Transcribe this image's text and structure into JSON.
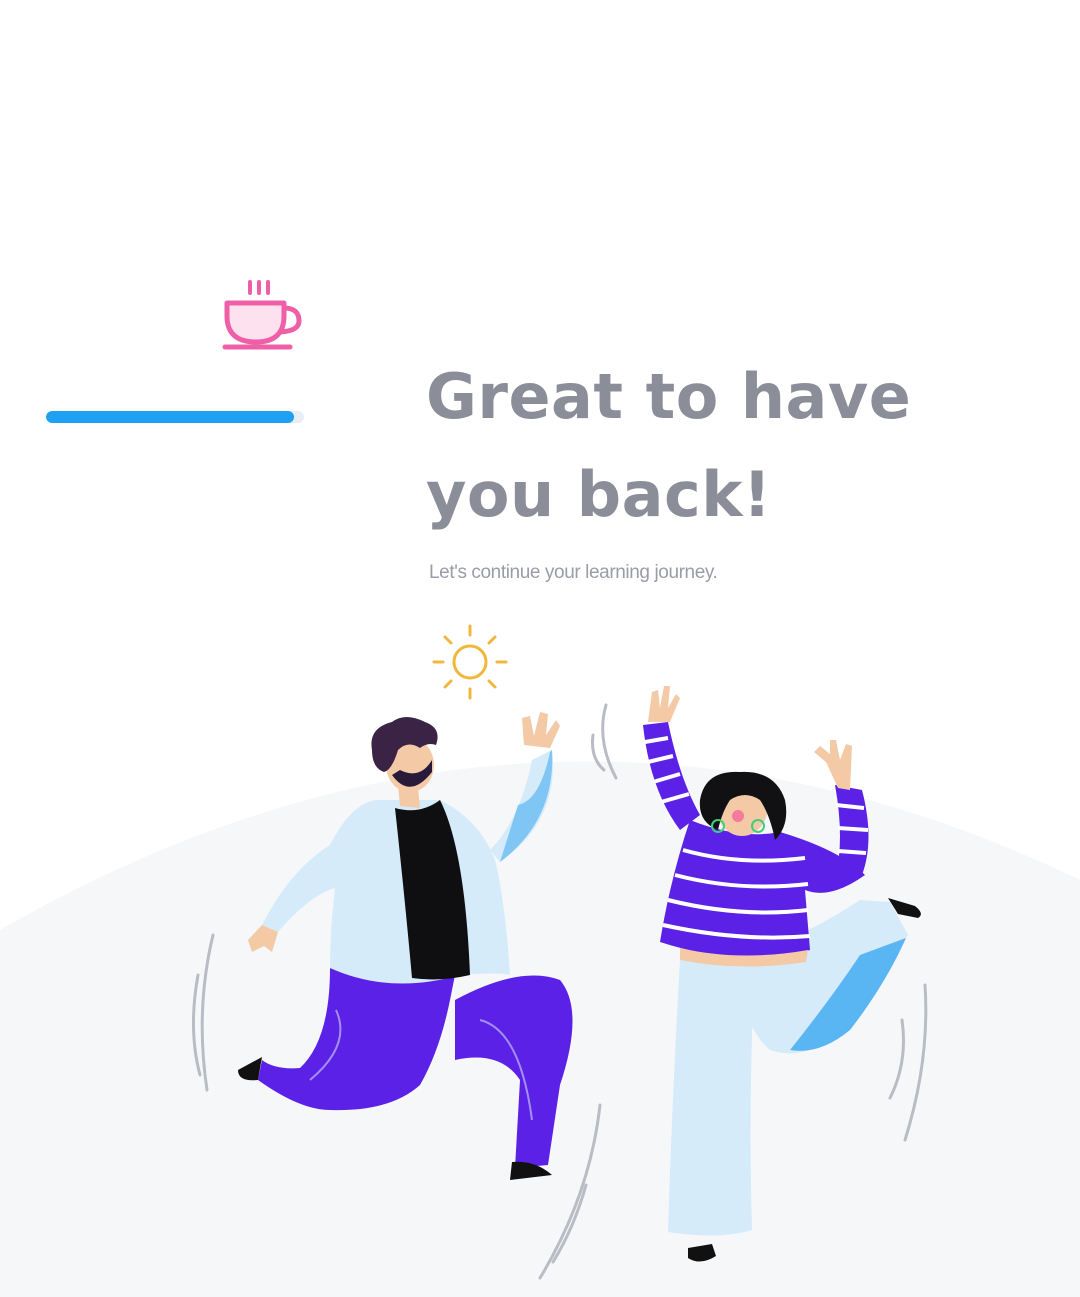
{
  "welcome": {
    "headline_line1": "Great to have",
    "headline_line2": "you back!",
    "subtitle": "Let's continue your learning journey."
  },
  "progress": {
    "fraction": 0.96
  },
  "icons": {
    "coffee": "coffee-cup-icon",
    "sun": "sun-icon"
  },
  "colors": {
    "accent_blue": "#1ea1f2",
    "coffee_pink": "#ef5fa7",
    "sun_yellow": "#f0b73e",
    "heading_gray": "#8b8e99",
    "pants_purple": "#5b21e6",
    "shirt_light_blue": "#d6ebfa"
  }
}
